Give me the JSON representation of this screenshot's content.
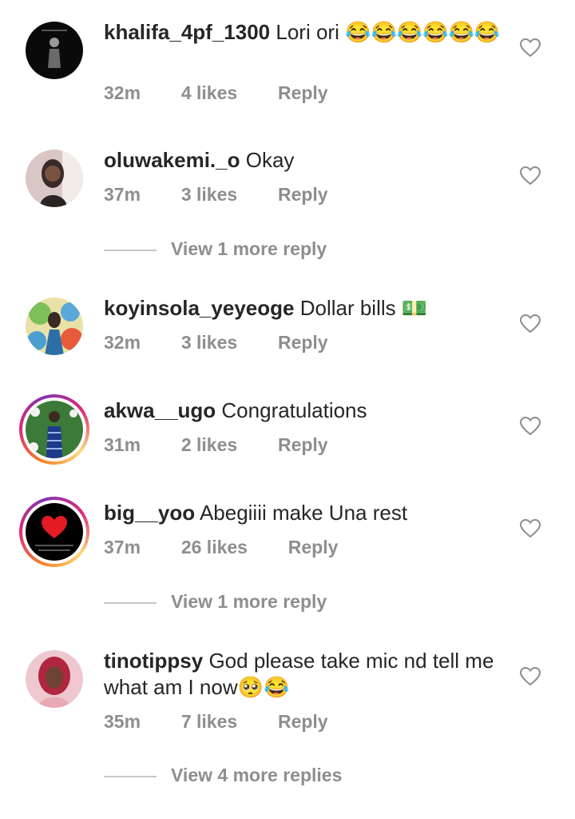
{
  "comments": [
    {
      "username": "khalifa_4pf_1300",
      "text": "Lori ori 😂😂😂😂😂😂",
      "time": "32m",
      "likes": "4 likes",
      "reply": "Reply"
    },
    {
      "username": "oluwakemi._o",
      "text": "Okay",
      "time": "37m",
      "likes": "3 likes",
      "reply": "Reply",
      "more_replies": "View 1 more reply"
    },
    {
      "username": "koyinsola_yeyeoge",
      "text": "Dollar bills 💵",
      "time": "32m",
      "likes": "3 likes",
      "reply": "Reply"
    },
    {
      "username": "akwa__ugo",
      "text": "Congratulations",
      "time": "31m",
      "likes": "2 likes",
      "reply": "Reply"
    },
    {
      "username": "big__yoo",
      "text": "Abegiiii make Una rest",
      "time": "37m",
      "likes": "26 likes",
      "reply": "Reply",
      "more_replies": "View 1 more reply"
    },
    {
      "username": "tinotippsy",
      "text": "God please take mic nd tell me what am I now🥺😂",
      "time": "35m",
      "likes": "7 likes",
      "reply": "Reply",
      "more_replies": "View 4 more replies"
    }
  ],
  "icons": {
    "like": "heart-outline-icon"
  },
  "colors": {
    "text": "#262626",
    "meta": "#8e8e8e",
    "divider": "#c7c7c7"
  }
}
